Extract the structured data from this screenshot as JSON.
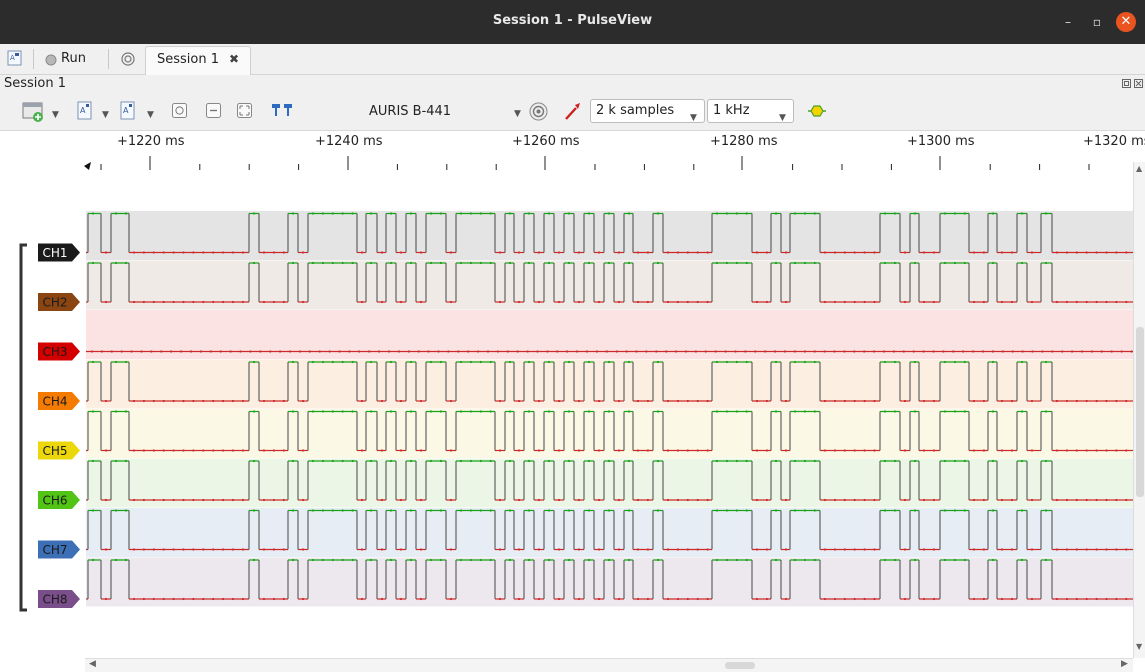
{
  "window": {
    "title": "Session 1 - PulseView"
  },
  "tabs": {
    "run_label": "Run",
    "session_tab_label": "Session 1",
    "session_tab_close": "✖"
  },
  "session": {
    "label": "Session 1"
  },
  "toolbar": {
    "device": "AURIS B-441",
    "samples": "2 k samples",
    "rate": "1 kHz"
  },
  "ruler": {
    "labels": [
      "+1220 ms",
      "+1240 ms",
      "+1260 ms",
      "+1280 ms",
      "+1300 ms",
      "+1320 ms"
    ]
  },
  "channels": [
    {
      "name": "CH1",
      "color": "#1a1a1a",
      "bg": "#e4e4e4",
      "active": true
    },
    {
      "name": "CH2",
      "color": "#8b4513",
      "bg": "#efeae6",
      "active": true
    },
    {
      "name": "CH3",
      "color": "#d40000",
      "bg": "#fbe3e3",
      "active": false
    },
    {
      "name": "CH4",
      "color": "#f47a00",
      "bg": "#fdeee2",
      "active": true
    },
    {
      "name": "CH5",
      "color": "#ecd80a",
      "bg": "#fbf9e6",
      "active": true
    },
    {
      "name": "CH6",
      "color": "#52c416",
      "bg": "#ebf6e6",
      "active": true
    },
    {
      "name": "CH7",
      "color": "#3c6fb6",
      "bg": "#e7edf4",
      "active": true
    },
    {
      "name": "CH8",
      "color": "#7a4e8a",
      "bg": "#ece8ee",
      "active": true
    }
  ],
  "waveform": {
    "highs": [
      [
        88,
        101
      ],
      [
        111,
        129
      ],
      [
        249,
        259
      ],
      [
        288,
        298
      ],
      [
        308,
        357
      ],
      [
        366,
        377
      ],
      [
        386,
        396
      ],
      [
        406,
        416
      ],
      [
        426,
        446
      ],
      [
        456,
        495
      ],
      [
        505,
        514
      ],
      [
        524,
        534
      ],
      [
        544,
        554
      ],
      [
        564,
        574
      ],
      [
        584,
        594
      ],
      [
        604,
        614
      ],
      [
        624,
        633
      ],
      [
        653,
        663
      ],
      [
        712,
        752
      ],
      [
        771,
        781
      ],
      [
        790,
        820
      ],
      [
        880,
        900
      ],
      [
        910,
        919
      ],
      [
        940,
        969
      ],
      [
        988,
        997
      ],
      [
        1017,
        1027
      ],
      [
        1041,
        1052
      ]
    ]
  },
  "colors": {
    "high_line": "#1aa21a",
    "low_line": "#cc2a2a",
    "edge_line": "#555555",
    "accent": "#e95420"
  }
}
